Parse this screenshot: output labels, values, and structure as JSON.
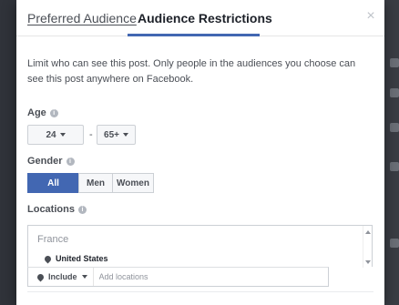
{
  "tabs": {
    "preferred": "Preferred Audience",
    "restrictions": "Audience Restrictions",
    "close": "×"
  },
  "description": "Limit who can see this post. Only people in the audiences you choose can see this post anywhere on Facebook.",
  "age": {
    "label": "Age",
    "min": "24",
    "max": "65+",
    "separator": "-"
  },
  "gender": {
    "label": "Gender",
    "options": [
      "All",
      "Men",
      "Women"
    ],
    "selected": "All"
  },
  "locations": {
    "label": "Locations",
    "country": "France",
    "items": [
      "United States"
    ],
    "include_label": "Include",
    "placeholder": "Add locations"
  },
  "icons": {
    "info": "info-icon",
    "pin": "pin-icon",
    "caret": "chevron-down-icon"
  },
  "colors": {
    "accent": "#4267b2",
    "text": "#4b4f56",
    "border": "#ccd0d5"
  }
}
